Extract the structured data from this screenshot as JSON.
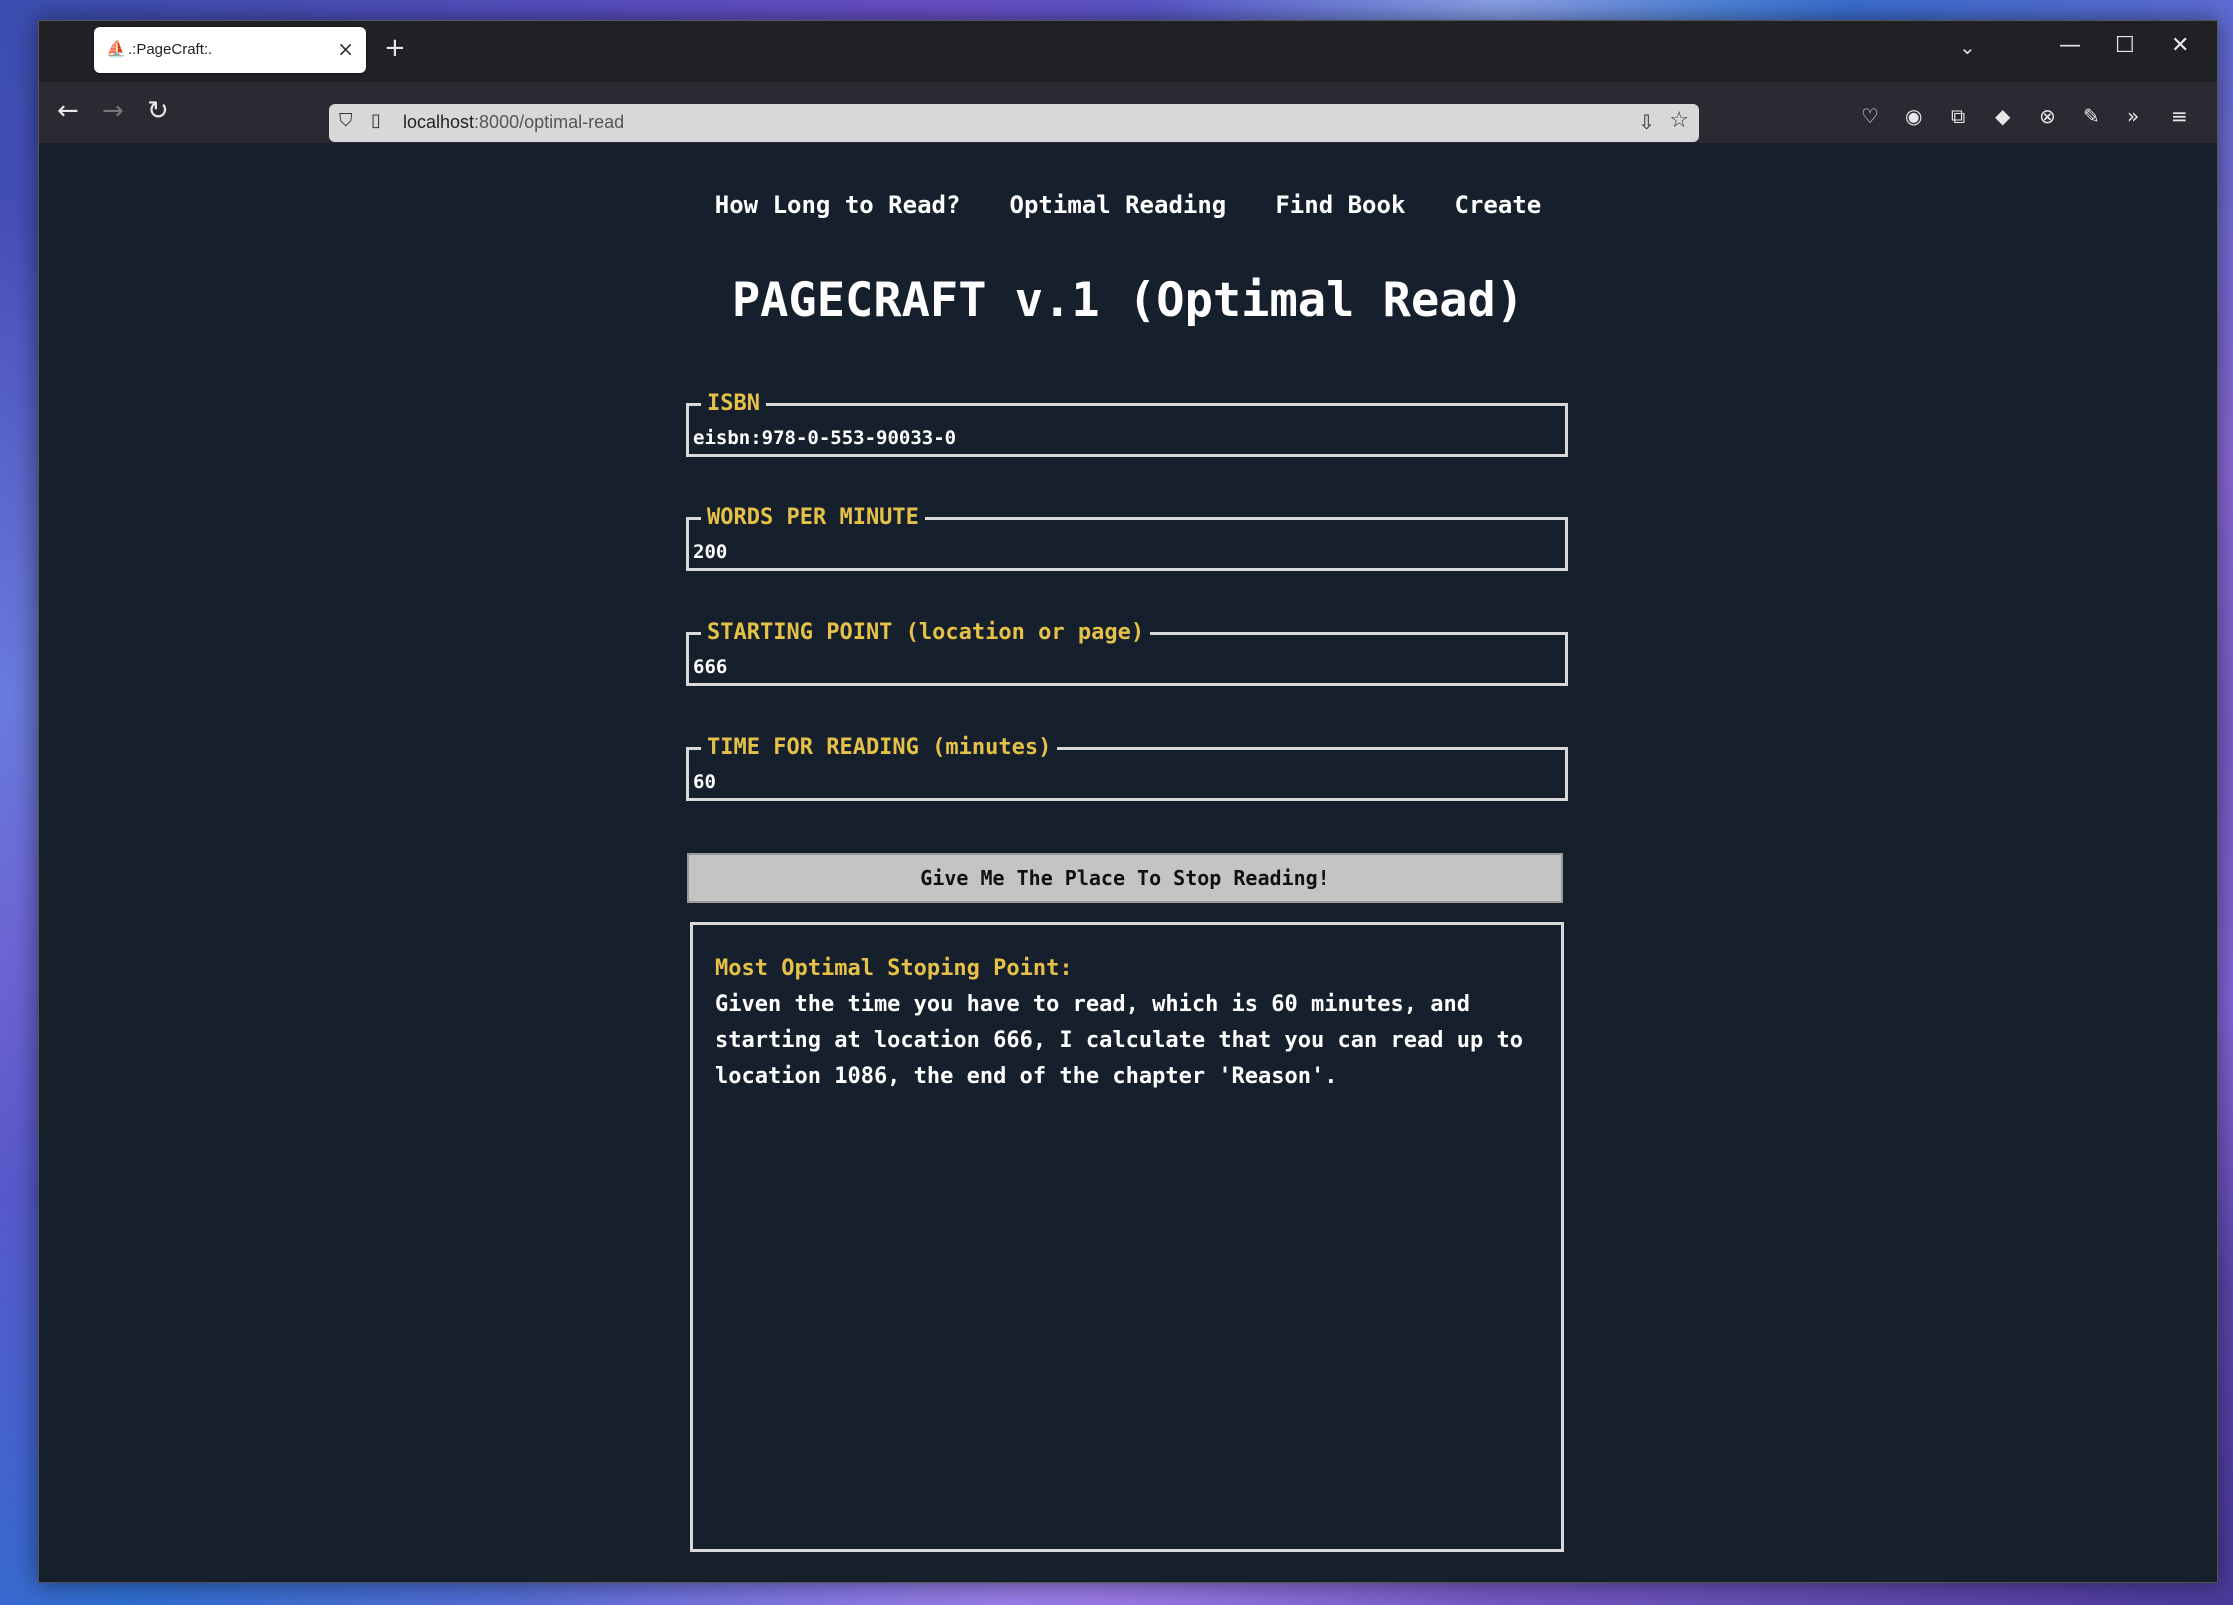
{
  "browser": {
    "tab_title": ".:PageCraft:.",
    "url_host": "localhost",
    "url_rest": ":8000/optimal-read"
  },
  "nav": {
    "items": [
      "How Long to Read?",
      "Optimal Reading",
      "Find Book",
      "Create"
    ]
  },
  "page_title": "PAGECRAFT v.1 (Optimal Read)",
  "form": {
    "isbn": {
      "label": "ISBN",
      "value": "eisbn:978-0-553-90033-0"
    },
    "wpm": {
      "label": "WORDS PER MINUTE",
      "value": "200"
    },
    "start": {
      "label": "STARTING POINT (location or page)",
      "value": "666"
    },
    "time": {
      "label": "TIME FOR READING (minutes)",
      "value": "60"
    },
    "submit_label": "Give Me The Place To Stop Reading!"
  },
  "result": {
    "heading": "Most Optimal Stoping Point:",
    "text": "Given the time you have to read, which is 60 minutes, and starting at location 666, I calculate that you can read up to location 1086, the end of the chapter 'Reason'."
  },
  "colors": {
    "accent": "#e6c147",
    "background": "#16202c",
    "button": "#c4c4c4"
  }
}
